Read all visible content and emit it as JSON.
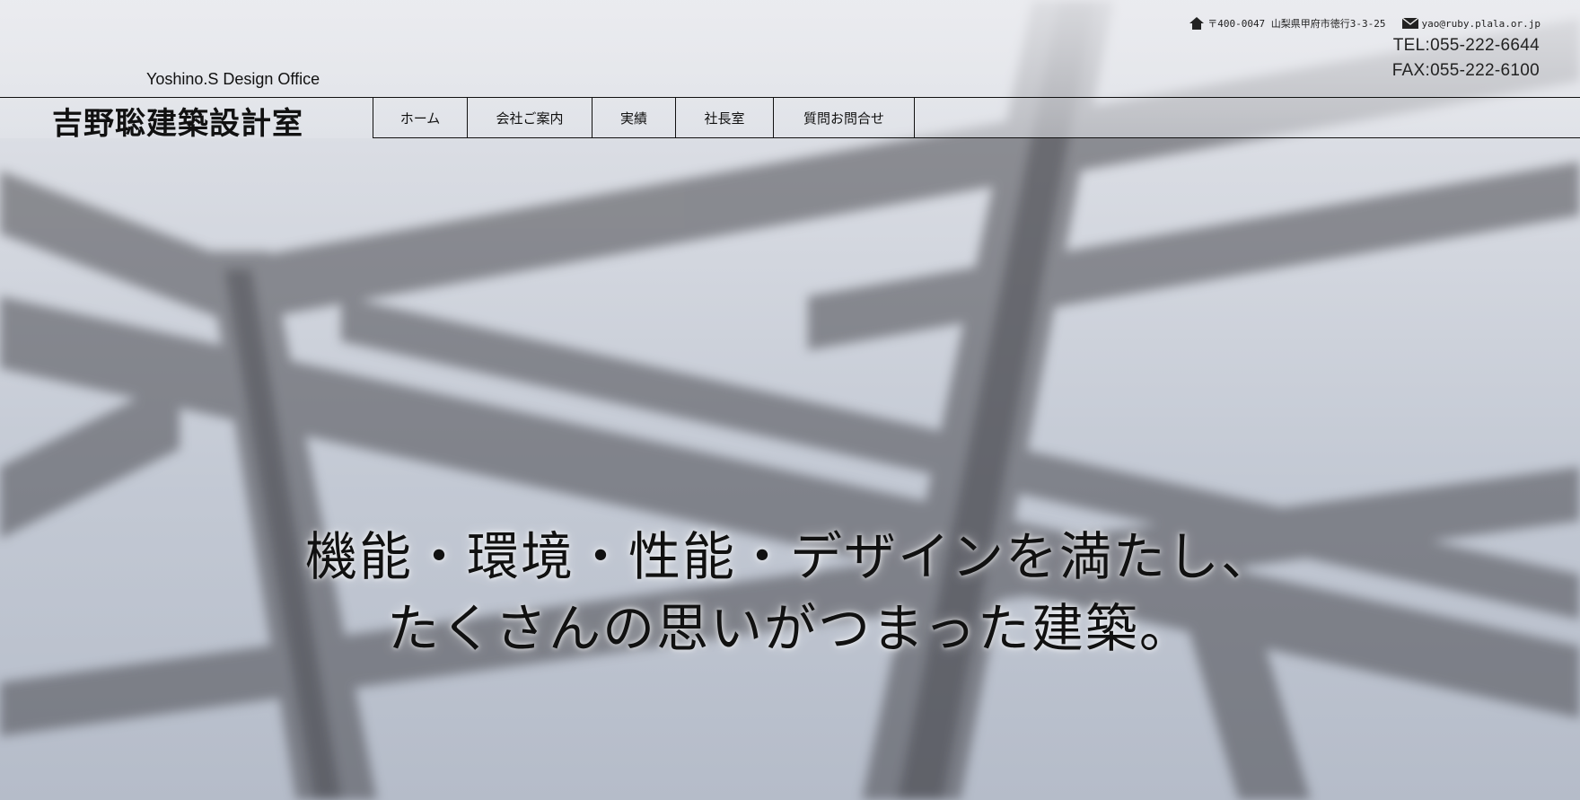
{
  "brand": {
    "name_en": "Yoshino.S Design Office",
    "name_jp": "吉野聡建築設計室"
  },
  "contact": {
    "address_icon": "home-icon",
    "address": "〒400-0047 山梨県甲府市徳行3-3-25",
    "email_icon": "mail-icon",
    "email": "yao@ruby.plala.or.jp",
    "tel": "TEL:055-222-6644",
    "fax": "FAX:055-222-6100"
  },
  "nav": {
    "items": [
      {
        "label": "ホーム"
      },
      {
        "label": "会社ご案内"
      },
      {
        "label": "実績"
      },
      {
        "label": "社長室"
      },
      {
        "label": "質問お問合せ"
      }
    ]
  },
  "hero": {
    "line1": "機能・環境・性能・デザインを満たし、",
    "line2": "たくさんの思いがつまった建築。"
  }
}
